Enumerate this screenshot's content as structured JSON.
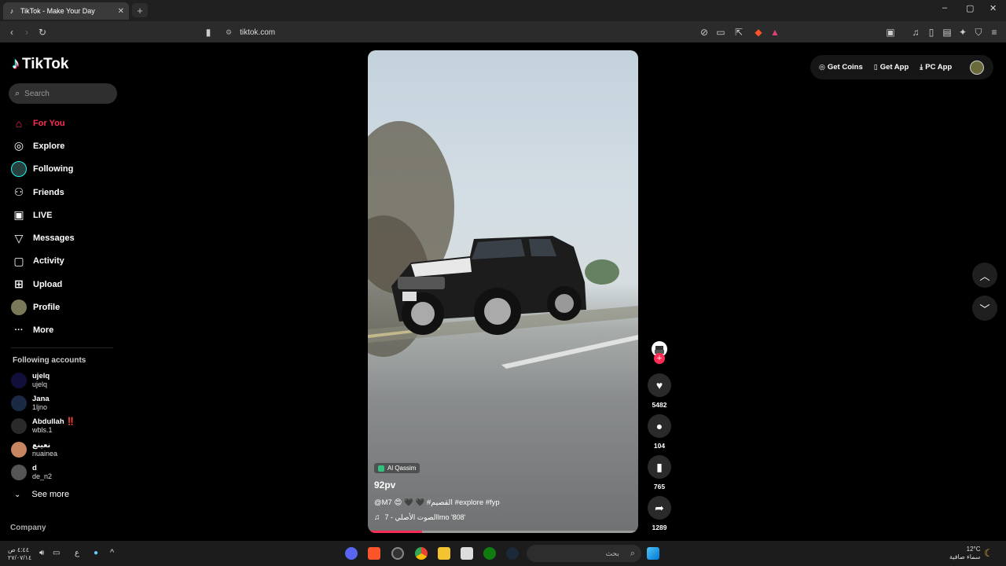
{
  "browser": {
    "tab_title": "TikTok - Make Your Day",
    "tab_close": "✕",
    "new_tab": "+",
    "url": "tiktok.com",
    "window_controls": [
      "–",
      "▢",
      "✕"
    ]
  },
  "sidebar": {
    "logo_text": "TikTok",
    "search_placeholder": "Search",
    "nav": [
      {
        "label": "For You",
        "icon": "home-icon",
        "glyph": "⌂"
      },
      {
        "label": "Explore",
        "icon": "compass-icon",
        "glyph": "◎"
      },
      {
        "label": "Following",
        "icon": "following-avatar-icon",
        "glyph": "◯"
      },
      {
        "label": "Friends",
        "icon": "friends-icon",
        "glyph": "⚇"
      },
      {
        "label": "LIVE",
        "icon": "live-tv-icon",
        "glyph": "▣"
      },
      {
        "label": "Messages",
        "icon": "send-icon",
        "glyph": "▽"
      },
      {
        "label": "Activity",
        "icon": "activity-icon",
        "glyph": "▢"
      },
      {
        "label": "Upload",
        "icon": "upload-plus-icon",
        "glyph": "⊞"
      },
      {
        "label": "Profile",
        "icon": "profile-avatar-icon",
        "glyph": "●"
      },
      {
        "label": "More",
        "icon": "more-dots-icon",
        "glyph": "···"
      }
    ],
    "following_accounts_title": "Following accounts",
    "accounts": [
      {
        "name": "ujelq",
        "handle": "ujelq",
        "color": "#10103a"
      },
      {
        "name": "Jana",
        "handle": "1ljno",
        "color": "#1b2a44"
      },
      {
        "name": "Abdullah ‼️",
        "handle": "wbls.1",
        "color": "#2a2a2a"
      },
      {
        "name": "نعينع",
        "handle": "nuainea",
        "color": "#c7865f"
      },
      {
        "name": "d",
        "handle": "de_n2",
        "color": "#555555"
      }
    ],
    "see_more": "See more",
    "company": "Company"
  },
  "header": {
    "get_coins": "Get Coins",
    "get_app": "Get App",
    "pc_app": "PC App"
  },
  "video": {
    "location": "Al Qassim",
    "username": "92pv",
    "description": "@M7 😍 🖤 🖤 #القصيم #explore #fyp",
    "music": "الصوت الأصلي - 7lmo '808'",
    "progress": 0.2
  },
  "actions": {
    "likes": "5482",
    "comments": "104",
    "saves": "765",
    "shares": "1289"
  },
  "taskbar": {
    "search_text": "بحث",
    "weather_temp": "12°C",
    "weather_text": "سماء صافية",
    "time": "٤:٤٤ ص",
    "date": "٢٧/٠٧/١٤"
  },
  "colors": {
    "accent": "#fe2c55",
    "background": "#000000"
  }
}
